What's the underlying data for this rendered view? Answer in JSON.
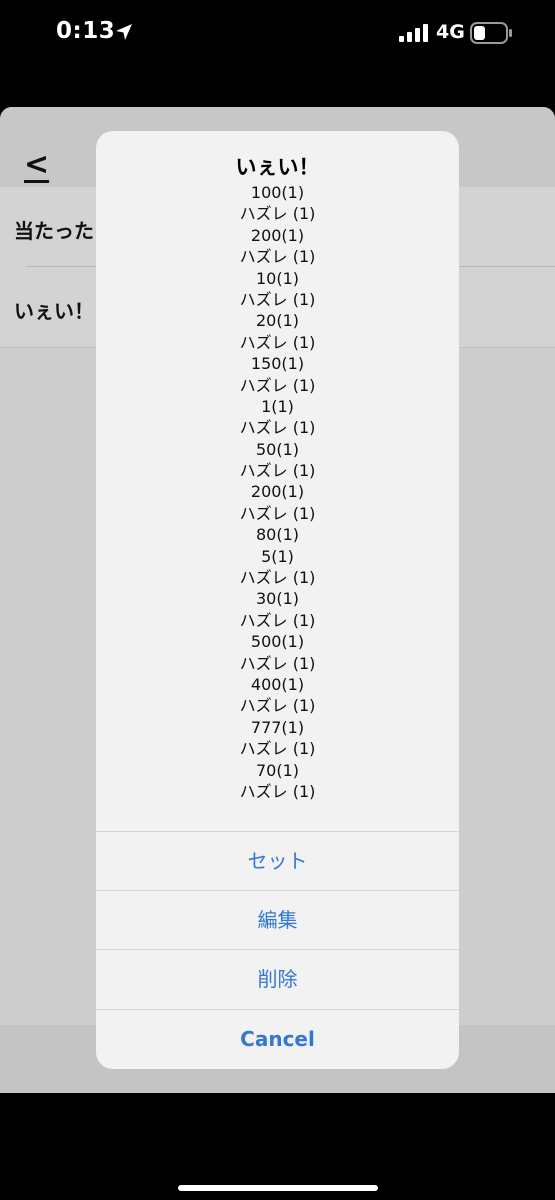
{
  "status_bar": {
    "time": "0:13",
    "network": "4G",
    "location_icon": "location-arrow-icon",
    "signal_icon": "cellular-signal-icon",
    "battery_icon": "battery-icon"
  },
  "app": {
    "back_label": "<",
    "list_items": [
      {
        "label": "当たった"
      },
      {
        "label": "いぇい！"
      }
    ]
  },
  "alert": {
    "title": "いぇい！",
    "message_lines": [
      "100(1)",
      "ハズレ (1)",
      "200(1)",
      "ハズレ (1)",
      "10(1)",
      "ハズレ (1)",
      "20(1)",
      "ハズレ (1)",
      "150(1)",
      "ハズレ (1)",
      "1(1)",
      "ハズレ (1)",
      "50(1)",
      "ハズレ (1)",
      "200(1)",
      "ハズレ (1)",
      "80(1)",
      "5(1)",
      "ハズレ (1)",
      "30(1)",
      "ハズレ (1)",
      "500(1)",
      "ハズレ (1)",
      "400(1)",
      "ハズレ (1)",
      "777(1)",
      "ハズレ (1)",
      "70(1)",
      "ハズレ (1)"
    ],
    "actions": {
      "set": "セット",
      "edit": "編集",
      "delete": "削除",
      "cancel": "Cancel"
    }
  },
  "colors": {
    "action_blue": "#3478d6",
    "alert_background": "#f2f2f3",
    "dimmed_sheet": "#cdcdcd"
  }
}
